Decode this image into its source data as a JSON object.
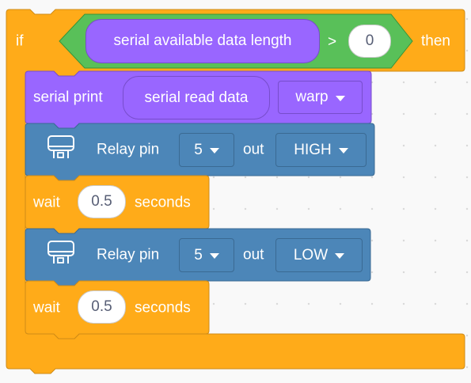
{
  "colors": {
    "control": "#ffab19",
    "control_border": "#cf8b17",
    "operator": "#59c059",
    "operator_border": "#389438",
    "serial": "#9966ff",
    "serial_border": "#774dcb",
    "relay": "#4c86b8",
    "relay_border": "#3a6a93"
  },
  "if_block": {
    "if_label": "if",
    "then_label": "then",
    "condition": {
      "reporter_label": "serial available data length",
      "operator": ">",
      "value": "0"
    }
  },
  "serial_print": {
    "label": "serial print",
    "reporter_label": "serial read data",
    "mode": "warp"
  },
  "relay_high": {
    "icon": "relay-icon",
    "label": "Relay pin",
    "pin": "5",
    "out_label": "out",
    "level": "HIGH"
  },
  "wait_1": {
    "label": "wait",
    "value": "0.5",
    "unit": "seconds"
  },
  "relay_low": {
    "icon": "relay-icon",
    "label": "Relay pin",
    "pin": "5",
    "out_label": "out",
    "level": "LOW"
  },
  "wait_2": {
    "label": "wait",
    "value": "0.5",
    "unit": "seconds"
  }
}
